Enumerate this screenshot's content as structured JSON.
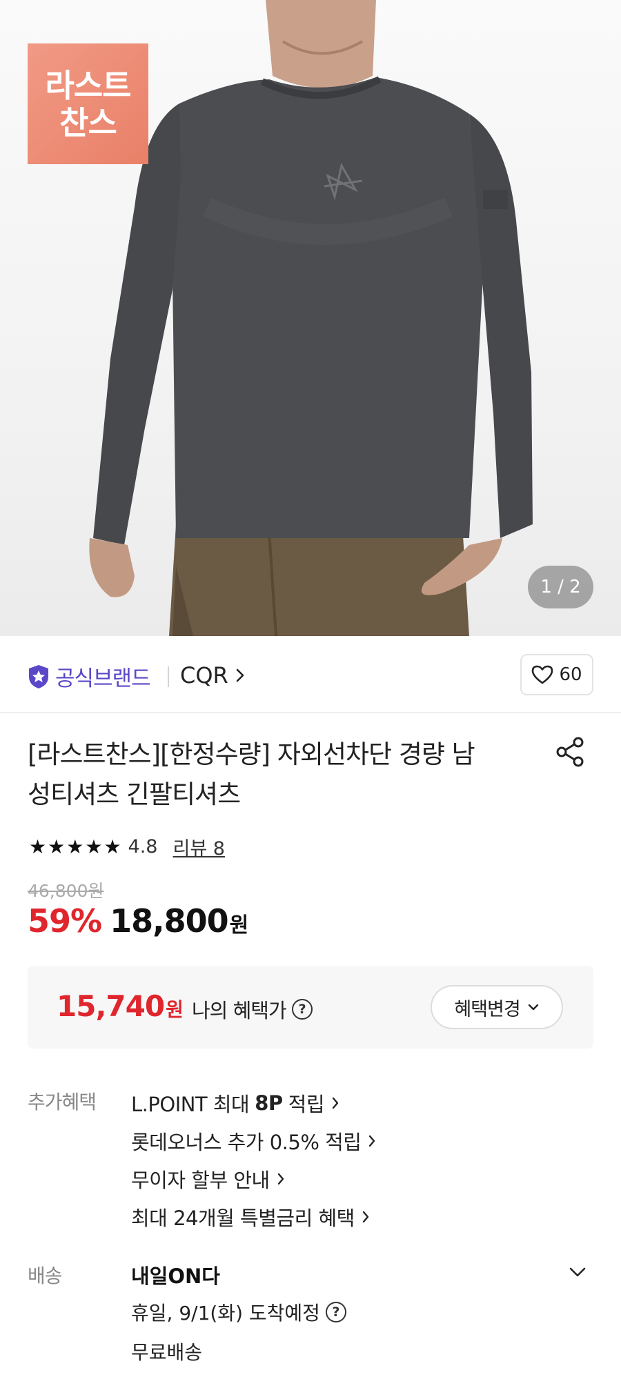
{
  "badge": {
    "line1": "라스트",
    "line2": "찬스"
  },
  "image_counter": "1 / 2",
  "brand": {
    "official_label": "공식브랜드",
    "name": "CQR",
    "like_count": "60"
  },
  "product": {
    "title_line1": "[라스트찬스][한정수량] 자외선차단 경량 남",
    "title_line2": "성티셔츠 긴팔티셔츠",
    "rating": "4.8",
    "review_label": "리뷰 8",
    "original_price": "46,800원",
    "discount": "59%",
    "price": "18,800",
    "price_unit": "원"
  },
  "benefit": {
    "price": "15,740",
    "unit": "원",
    "label": "나의 혜택가",
    "change_button": "혜택변경"
  },
  "extra_benefits": {
    "label": "추가혜택",
    "items": [
      {
        "pre": "L.POINT 최대",
        "bold": "8P",
        "post": "적립"
      },
      {
        "text": "롯데오너스 추가 0.5% 적립"
      },
      {
        "text": "무이자 할부 안내"
      },
      {
        "text": "최대 24개월 특별금리 혜택"
      }
    ]
  },
  "delivery": {
    "label": "배송",
    "title": "내일ON다",
    "arrival": "휴일, 9/1(화) 도착예정",
    "fee": "무료배송"
  },
  "colors": {
    "accent_red": "#e0262d",
    "brand_purple": "#5a48c8",
    "badge_coral": "#ee8c75"
  }
}
